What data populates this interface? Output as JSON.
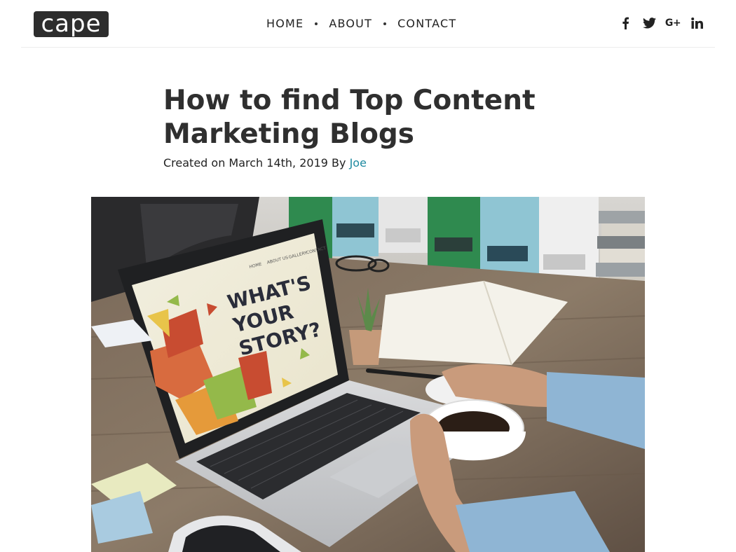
{
  "header": {
    "logo_text": "cape",
    "nav": [
      {
        "label": "HOME"
      },
      {
        "label": "ABOUT"
      },
      {
        "label": "CONTACT"
      }
    ],
    "social": [
      "facebook-icon",
      "twitter-icon",
      "google-plus-icon",
      "linkedin-icon"
    ],
    "google_plus_label": "G+",
    "linkedin_label": "in"
  },
  "article": {
    "title": "How to find Top Content Marketing Blogs",
    "created_prefix": "Created on March 14th, 2019 By",
    "author": "Joe"
  },
  "hero": {
    "screen_nav": [
      "HOME",
      "ABOUT US",
      "GALLERY",
      "CONTACT"
    ],
    "screen_headline": [
      "WHAT'S",
      "YOUR",
      "STORY?"
    ]
  },
  "colors": {
    "accent_link": "#1e8aa0",
    "text": "#2b2b2b",
    "logo_bg": "#2d2d2d"
  }
}
